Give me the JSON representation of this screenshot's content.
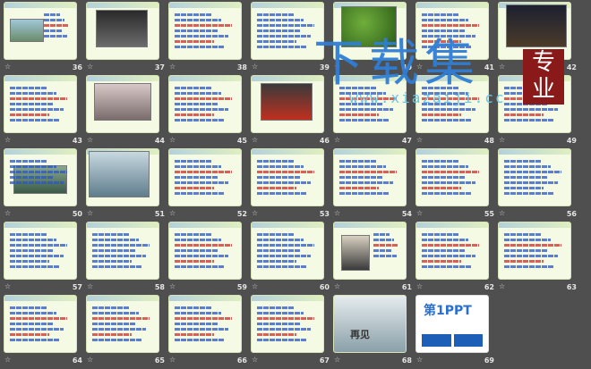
{
  "watermark": {
    "title": "下载集",
    "badge": "专业",
    "url": "www.xiazaiji.cc"
  },
  "slides": [
    {
      "num": "36",
      "badge": "",
      "pic": "boats",
      "red": true
    },
    {
      "num": "37",
      "badge": "",
      "pic": "dark",
      "red": true
    },
    {
      "num": "38",
      "badge": "",
      "pic": "",
      "red": true
    },
    {
      "num": "39",
      "badge": "",
      "pic": "",
      "red": false
    },
    {
      "num": "40",
      "badge": "",
      "pic": "plant",
      "red": false
    },
    {
      "num": "41",
      "badge": "",
      "pic": "",
      "red": true
    },
    {
      "num": "42",
      "badge": "",
      "pic": "night",
      "red": false
    },
    {
      "num": "43",
      "badge": "",
      "pic": "",
      "red": true
    },
    {
      "num": "44",
      "badge": "",
      "pic": "sunset",
      "red": false
    },
    {
      "num": "45",
      "badge": "",
      "pic": "",
      "red": true
    },
    {
      "num": "46",
      "badge": "",
      "pic": "roof",
      "red": false
    },
    {
      "num": "47",
      "badge": "",
      "pic": "",
      "red": true
    },
    {
      "num": "48",
      "badge": "",
      "pic": "",
      "red": true
    },
    {
      "num": "49",
      "badge": "",
      "pic": "",
      "red": true
    },
    {
      "num": "50",
      "badge": "",
      "pic": "pond",
      "red": false
    },
    {
      "num": "51",
      "badge": "",
      "pic": "water",
      "red": false
    },
    {
      "num": "52",
      "badge": "",
      "pic": "",
      "red": true
    },
    {
      "num": "53",
      "badge": "",
      "pic": "",
      "red": true
    },
    {
      "num": "54",
      "badge": "",
      "pic": "",
      "red": true
    },
    {
      "num": "55",
      "badge": "",
      "pic": "",
      "red": true
    },
    {
      "num": "56",
      "badge": "",
      "pic": "",
      "red": false
    },
    {
      "num": "57",
      "badge": "",
      "pic": "",
      "red": false
    },
    {
      "num": "58",
      "badge": "",
      "pic": "",
      "red": false
    },
    {
      "num": "59",
      "badge": "",
      "pic": "",
      "red": true
    },
    {
      "num": "60",
      "badge": "",
      "pic": "",
      "red": false
    },
    {
      "num": "61",
      "badge": "",
      "pic": "portrait",
      "red": true
    },
    {
      "num": "62",
      "badge": "",
      "pic": "",
      "red": true
    },
    {
      "num": "63",
      "badge": "",
      "pic": "",
      "red": true
    },
    {
      "num": "64",
      "badge": "",
      "pic": "",
      "red": true
    },
    {
      "num": "65",
      "badge": "",
      "pic": "",
      "red": true
    },
    {
      "num": "66",
      "badge": "",
      "pic": "",
      "red": true
    },
    {
      "num": "67",
      "badge": "",
      "pic": "",
      "red": true
    },
    {
      "num": "68",
      "badge": "",
      "pic": "again",
      "red": false
    },
    {
      "num": "69",
      "badge": "",
      "pic": "ppt",
      "red": false
    }
  ],
  "again_text": "再见",
  "ppt_logo": "第1PPT"
}
